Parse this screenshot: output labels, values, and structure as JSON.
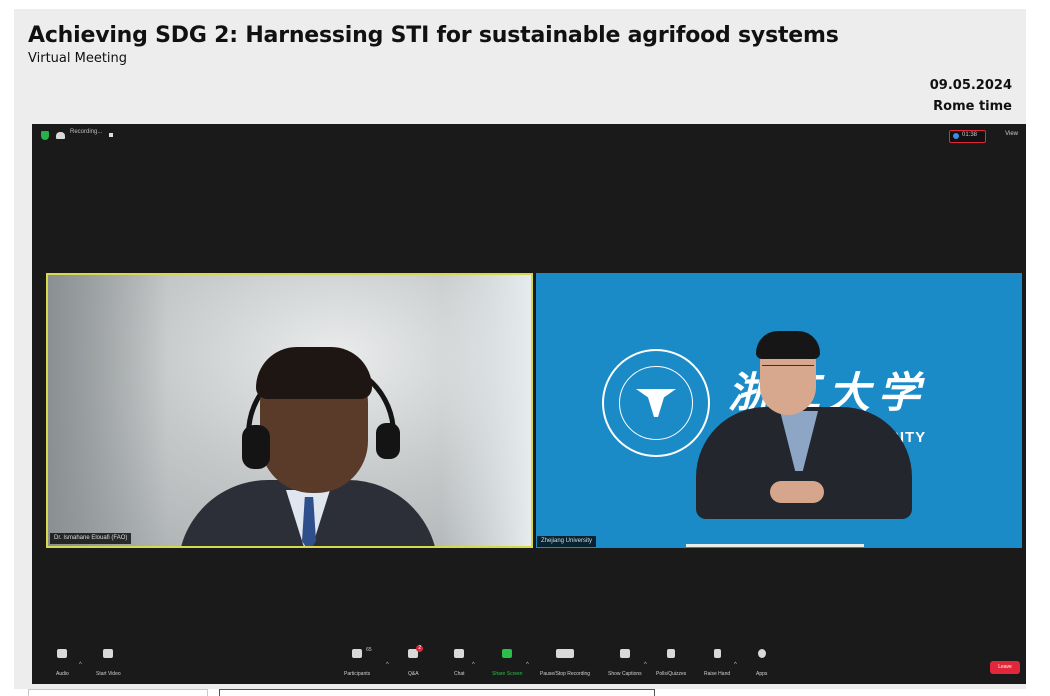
{
  "header": {
    "title": "Achieving SDG 2: Harnessing STI for sustainable agrifood systems",
    "subtitle": "Virtual Meeting",
    "date": "09.05.2024",
    "timezone": "Rome time"
  },
  "meeting": {
    "recording_label": "Recording...",
    "timer": "01:38",
    "view_label": "View",
    "participants": [
      {
        "name": "Dr. Ismahane Elouafi (FAO)",
        "icon": "person-headset"
      },
      {
        "name": "Zhejiang University",
        "icon": "person-university-background"
      }
    ],
    "university_text": "ERSITY",
    "calligraphy": "浙江大学",
    "emblem_text": "ZHEJIANG UNIVERSITY"
  },
  "toolbar": {
    "audio": "Audio",
    "video": "Start Video",
    "participants": "Participants",
    "participants_count": "65",
    "qa": "Q&A",
    "qa_badge": "2",
    "chat": "Chat",
    "share": "Share Screen",
    "record": "Pause/Stop Recording",
    "captions": "Show Captions",
    "polls": "Polls/Quizzes",
    "raise": "Raise Hand",
    "apps": "Apps",
    "end": "Leave"
  },
  "colors": {
    "accent_green": "#2cbf4b",
    "end_red": "#e0283a",
    "active_speaker": "#d7d84a",
    "university_blue": "#1b8bc8"
  }
}
